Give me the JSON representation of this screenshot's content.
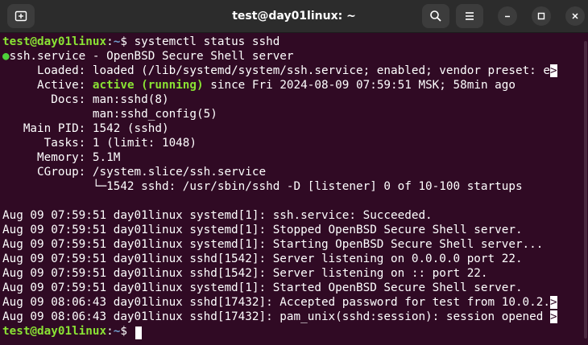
{
  "window": {
    "title": "test@day01linux: ~"
  },
  "prompt": {
    "user_host": "test@day01linux",
    "colon": ":",
    "path": "~",
    "symbol": "$ "
  },
  "command": "systemctl status sshd",
  "status": {
    "dot": "●",
    "header": "ssh.service - OpenBSD Secure Shell server",
    "loaded_label": "     Loaded: ",
    "loaded_value": "loaded (/lib/systemd/system/ssh.service; enabled; vendor preset: e",
    "truncation_marker": ">",
    "active_label": "     Active: ",
    "active_state": "active (running)",
    "active_since": " since Fri 2024-08-09 07:59:51 MSK; 58min ago",
    "docs_line1": "       Docs: man:sshd(8)",
    "docs_line2": "             man:sshd_config(5)",
    "main_pid": "   Main PID: 1542 (sshd)",
    "tasks": "      Tasks: 1 (limit: 1048)",
    "memory": "     Memory: 5.1M",
    "cgroup": "     CGroup: /system.slice/ssh.service",
    "cgroup_child": "             └─1542 sshd: /usr/sbin/sshd -D [listener] 0 of 10-100 startups"
  },
  "log": [
    {
      "text": "Aug 09 07:59:51 day01linux systemd[1]: ssh.service: Succeeded."
    },
    {
      "text": "Aug 09 07:59:51 day01linux systemd[1]: Stopped OpenBSD Secure Shell server."
    },
    {
      "text": "Aug 09 07:59:51 day01linux systemd[1]: Starting OpenBSD Secure Shell server..."
    },
    {
      "text": "Aug 09 07:59:51 day01linux sshd[1542]: Server listening on 0.0.0.0 port 22."
    },
    {
      "text": "Aug 09 07:59:51 day01linux sshd[1542]: Server listening on :: port 22."
    },
    {
      "text": "Aug 09 07:59:51 day01linux systemd[1]: Started OpenBSD Secure Shell server."
    },
    {
      "text": "Aug 09 08:06:43 day01linux sshd[17432]: Accepted password for test from 10.0.2.",
      "truncated": true
    },
    {
      "text": "Aug 09 08:06:43 day01linux sshd[17432]: pam_unix(sshd:session): session opened ",
      "truncated": true
    }
  ],
  "colors": {
    "background": "#300a24",
    "prompt_user": "#8ae234",
    "prompt_path": "#729fcf",
    "active": "#8ae234",
    "status_dot": "#4ed13a"
  },
  "icons": {
    "new_tab": "new-tab-icon",
    "search": "search-icon",
    "menu": "hamburger-menu-icon",
    "minimize": "minimize-icon",
    "maximize": "maximize-icon",
    "close": "close-icon"
  }
}
